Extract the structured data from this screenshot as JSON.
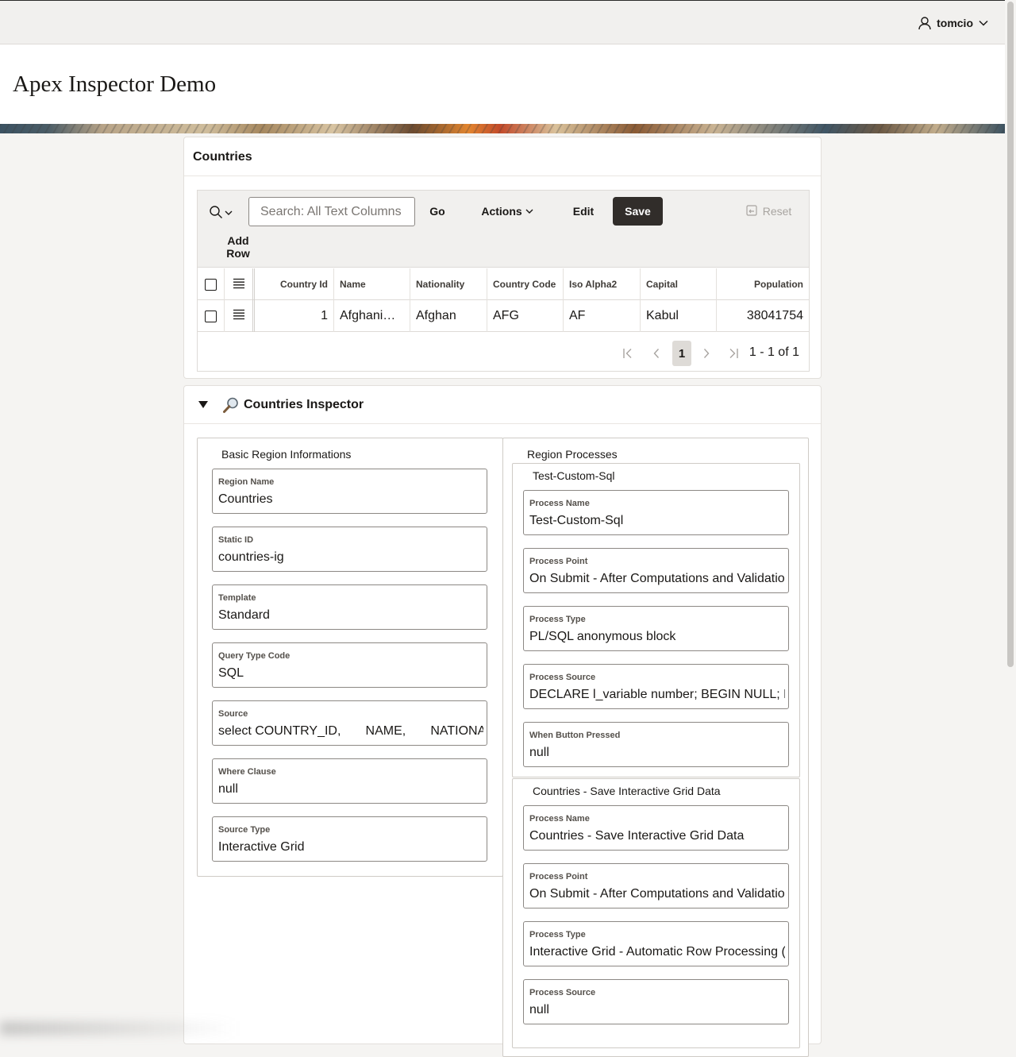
{
  "header": {
    "username": "tomcio"
  },
  "app": {
    "title": "Apex Inspector Demo"
  },
  "countries": {
    "title": "Countries",
    "toolbar": {
      "search_placeholder": "Search: All Text Columns",
      "go_label": "Go",
      "actions_label": "Actions",
      "edit_label": "Edit",
      "save_label": "Save",
      "reset_label": "Reset",
      "add_row_label": "Add Row"
    },
    "columns": [
      "Country Id",
      "Name",
      "Nationality",
      "Country Code",
      "Iso Alpha2",
      "Capital",
      "Population"
    ],
    "rows": [
      {
        "country_id": "1",
        "name": "Afghani…",
        "nationality": "Afghan",
        "country_code": "AFG",
        "iso_alpha2": "AF",
        "capital": "Kabul",
        "population": "38041754"
      }
    ],
    "pagination": {
      "current_page": "1",
      "range_text": "1 - 1 of 1"
    }
  },
  "inspector": {
    "title": "Countries Inspector",
    "icon": "magnifying-glass-icon",
    "basic": {
      "legend": "Basic Region Informations",
      "fields": [
        {
          "label": "Region Name",
          "value": "Countries"
        },
        {
          "label": "Static ID",
          "value": "countries-ig"
        },
        {
          "label": "Template",
          "value": "Standard"
        },
        {
          "label": "Query Type Code",
          "value": "SQL"
        },
        {
          "label": "Source",
          "value": "select COUNTRY_ID,       NAME,       NATIONALITY"
        },
        {
          "label": "Where Clause",
          "value": "null"
        },
        {
          "label": "Source Type",
          "value": "Interactive Grid"
        }
      ]
    },
    "processes": {
      "legend": "Region Processes",
      "groups": [
        {
          "legend": "Test-Custom-Sql",
          "fields": [
            {
              "label": "Process Name",
              "value": "Test-Custom-Sql"
            },
            {
              "label": "Process Point",
              "value": "On Submit - After Computations and Validations"
            },
            {
              "label": "Process Type",
              "value": "PL/SQL anonymous block"
            },
            {
              "label": "Process Source",
              "value": "DECLARE l_variable number; BEGIN NULL; END;"
            },
            {
              "label": "When Button Pressed",
              "value": "null"
            }
          ]
        },
        {
          "legend": "Countries - Save Interactive Grid Data",
          "fields": [
            {
              "label": "Process Name",
              "value": "Countries - Save Interactive Grid Data"
            },
            {
              "label": "Process Point",
              "value": "On Submit - After Computations and Validations"
            },
            {
              "label": "Process Type",
              "value": "Interactive Grid - Automatic Row Processing (DML)"
            },
            {
              "label": "Process Source",
              "value": "null"
            }
          ]
        }
      ]
    }
  }
}
